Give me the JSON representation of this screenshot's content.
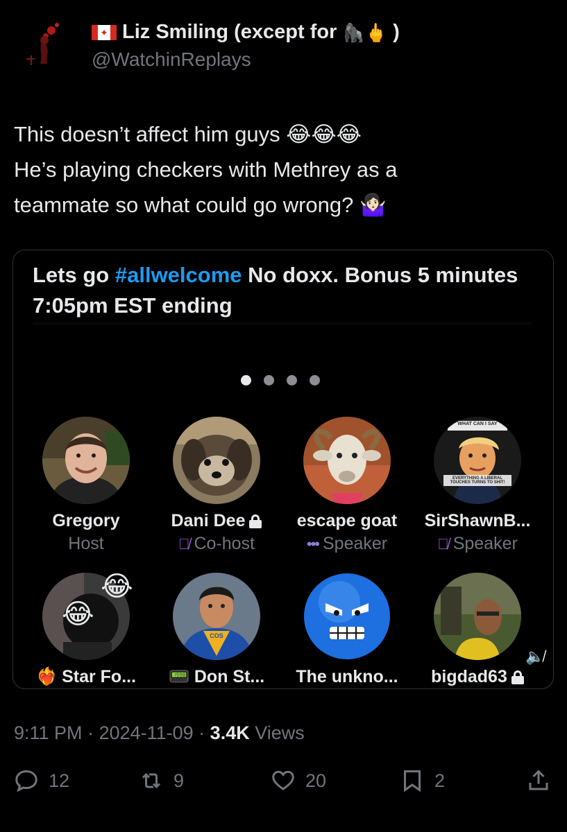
{
  "author": {
    "display_name": "Liz Smiling (except for",
    "name_emojis": "🦍🖕",
    "name_close": ")",
    "handle": "@WatchinReplays"
  },
  "tweet": {
    "line1_text": "This doesn’t affect him guys",
    "line1_emojis": "😂😂😂",
    "line2": "He’s playing checkers with Methrey as a",
    "line3_text": "teammate so what could go wrong?",
    "line3_emoji": "🤷🏻‍♀️"
  },
  "space": {
    "title_before": "Lets go",
    "hashtag": "#allwelcome",
    "title_after": "No doxx. Bonus 5 minutes 7:05pm EST ending",
    "page_dots": 4,
    "active_dot": 0,
    "participants": [
      {
        "name": "Gregory",
        "role": "Host"
      },
      {
        "name": "Dani Dee",
        "role": "Co-host"
      },
      {
        "name": "escape goat",
        "role": "Speaker"
      },
      {
        "name": "SirShawnB...",
        "role": "Speaker"
      },
      {
        "name": "Star Fo...",
        "role": ""
      },
      {
        "name": "Don St...",
        "role": ""
      },
      {
        "name": "The unkno...",
        "role": ""
      },
      {
        "name": "bigdad63",
        "role": ""
      }
    ],
    "emoji_badge": "😂",
    "prefix_emoji_1": "❤️‍🔥",
    "prefix_emoji_2": "📟",
    "trump_caption_top": "WHAT CAN I SAY",
    "trump_caption_bottom": "EVERYTHING A LIBERAL TOUCHES TURNS TO SHIT!",
    "cos_badge": "COS"
  },
  "meta": {
    "time": "9:11 PM",
    "sep1": " · ",
    "date": "2024-11-09",
    "sep2": " · ",
    "views_count": "3.4K",
    "views_label": " Views"
  },
  "actions": {
    "replies": "12",
    "reposts": "9",
    "likes": "20",
    "bookmarks": "2"
  }
}
